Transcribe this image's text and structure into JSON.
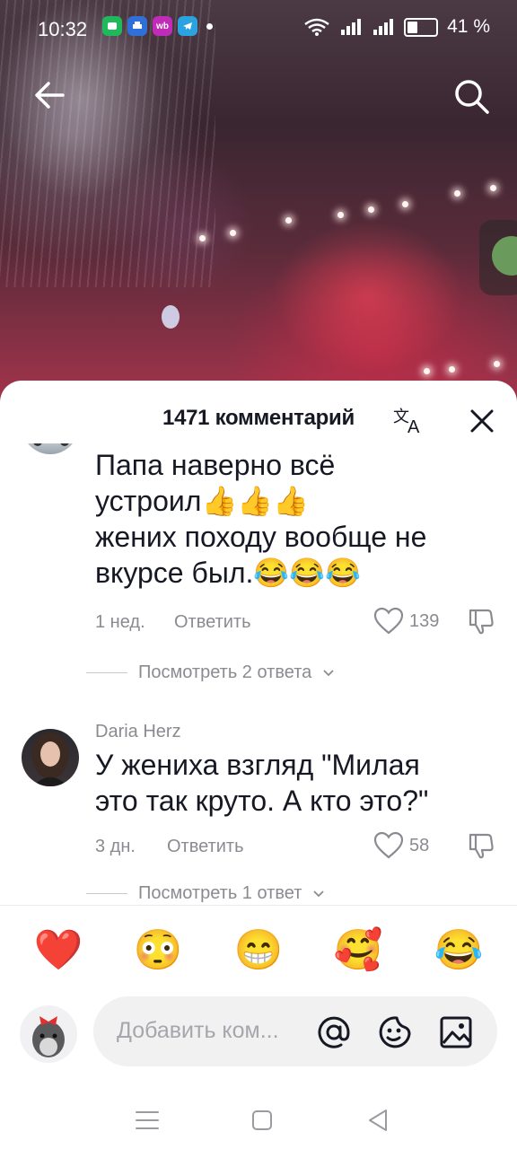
{
  "status_bar": {
    "time": "10:32",
    "apps": [
      {
        "icon": "android-messages-icon",
        "color": "#1fb85c",
        "label": ""
      },
      {
        "icon": "printer-icon",
        "color": "#2f6fd8",
        "label": ""
      },
      {
        "icon": "wb-app-icon",
        "color": "#c02bb8",
        "label": "wb"
      },
      {
        "icon": "telegram-icon",
        "color": "#2aa3e0",
        "label": ""
      }
    ],
    "battery_level": 0.41,
    "battery_text": "41 %"
  },
  "video": {
    "back_icon": "arrow-left-icon",
    "search_icon": "search-icon"
  },
  "sheet": {
    "title": "1471 комментарий",
    "translate_icon": "translate-icon",
    "close_icon": "close-icon"
  },
  "comments": [
    {
      "author": "",
      "text_lines": [
        "Папа наверно всё",
        "устроил👍👍👍",
        "жених походу вообще не",
        "вкурсе был.😂😂😂"
      ],
      "age": "1 нед.",
      "reply_label": "Ответить",
      "likes": "139",
      "view_replies": "Посмотреть 2 ответа"
    },
    {
      "author": "Daria Herz",
      "text_lines": [
        "У жениха взгляд \"Милая",
        "это так круто. А кто это?\""
      ],
      "age": "3 дн.",
      "reply_label": "Ответить",
      "likes": "58",
      "view_replies": "Посмотреть 1 ответ"
    }
  ],
  "quick_emojis": [
    "❤️",
    "😳",
    "😁",
    "🥰",
    "😂"
  ],
  "composer": {
    "placeholder": "Добавить ком...",
    "mention_icon": "at-sign-icon",
    "emoji_icon": "emoji-icon",
    "image_icon": "image-icon"
  },
  "nav_bar": {
    "menu_icon": "menu-icon",
    "home_icon": "home-square-icon",
    "back_icon": "back-triangle-icon"
  }
}
